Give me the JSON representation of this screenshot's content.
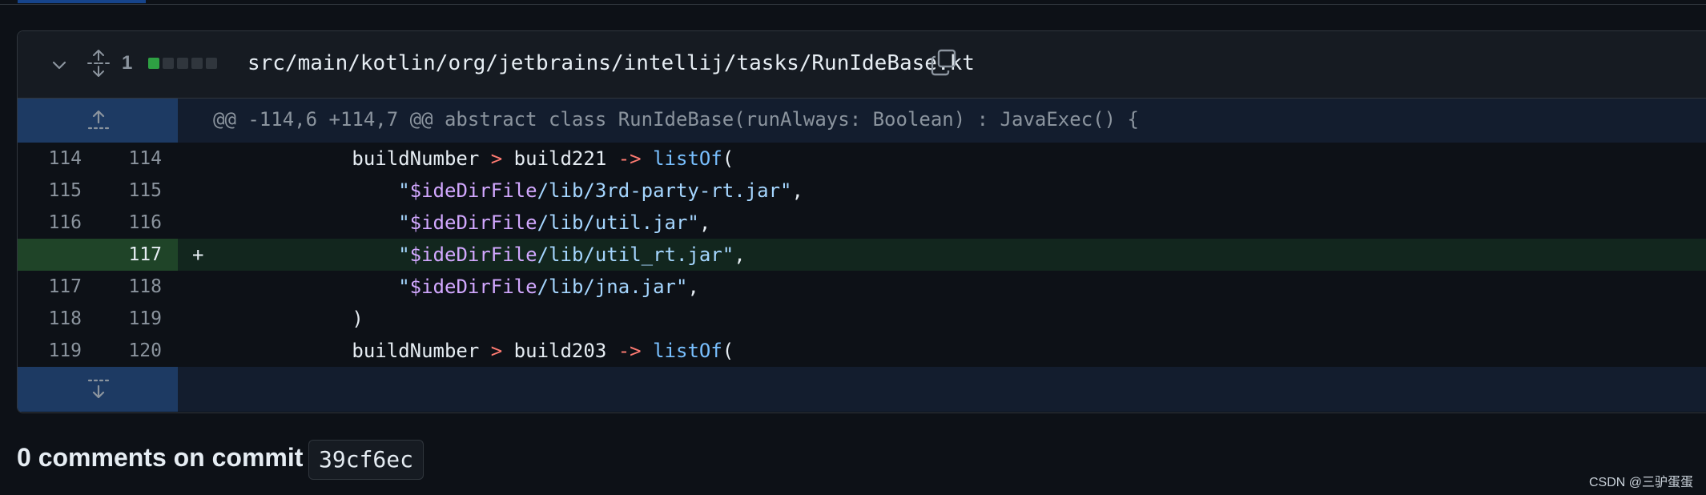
{
  "file": {
    "changed_count": "1",
    "diffstat": [
      "added",
      "neutral",
      "neutral",
      "neutral",
      "neutral"
    ],
    "path": "src/main/kotlin/org/jetbrains/intellij/tasks/RunIdeBase.kt",
    "icons": {
      "collapse": "chevron-down-icon",
      "expand_all": "unfold-icon",
      "copy": "copy-icon"
    }
  },
  "hunk": {
    "header": "@@ -114,6 +114,7 @@ abstract class RunIdeBase(runAlways: Boolean) : JavaExec() {"
  },
  "lines": [
    {
      "old": "114",
      "new": "114",
      "marker": "",
      "tokens": [
        [
          "",
          "            buildNumber "
        ],
        [
          "op",
          ">"
        ],
        [
          "",
          " build221 "
        ],
        [
          "op",
          "->"
        ],
        [
          "",
          " "
        ],
        [
          "fn",
          "listOf"
        ],
        [
          "",
          "("
        ]
      ]
    },
    {
      "old": "115",
      "new": "115",
      "marker": "",
      "tokens": [
        [
          "",
          "                "
        ],
        [
          "str",
          "\""
        ],
        [
          "var",
          "$ideDirFile"
        ],
        [
          "str",
          "/lib/3rd-party-rt.jar\""
        ],
        [
          "",
          ","
        ]
      ]
    },
    {
      "old": "116",
      "new": "116",
      "marker": "",
      "tokens": [
        [
          "",
          "                "
        ],
        [
          "str",
          "\""
        ],
        [
          "var",
          "$ideDirFile"
        ],
        [
          "str",
          "/lib/util.jar\""
        ],
        [
          "",
          ","
        ]
      ]
    },
    {
      "old": "",
      "new": "117",
      "marker": "+",
      "added": true,
      "tokens": [
        [
          "",
          "                "
        ],
        [
          "str",
          "\""
        ],
        [
          "var",
          "$ideDirFile"
        ],
        [
          "str",
          "/lib/util_rt.jar\""
        ],
        [
          "",
          ","
        ]
      ]
    },
    {
      "old": "117",
      "new": "118",
      "marker": "",
      "tokens": [
        [
          "",
          "                "
        ],
        [
          "str",
          "\""
        ],
        [
          "var",
          "$ideDirFile"
        ],
        [
          "str",
          "/lib/jna.jar\""
        ],
        [
          "",
          ","
        ]
      ]
    },
    {
      "old": "118",
      "new": "119",
      "marker": "",
      "tokens": [
        [
          "",
          "            )"
        ]
      ]
    },
    {
      "old": "119",
      "new": "120",
      "marker": "",
      "tokens": [
        [
          "",
          "            buildNumber "
        ],
        [
          "op",
          ">"
        ],
        [
          "",
          " build203 "
        ],
        [
          "op",
          "->"
        ],
        [
          "",
          " "
        ],
        [
          "fn",
          "listOf"
        ],
        [
          "",
          "("
        ]
      ]
    }
  ],
  "comments": {
    "title": "0 comments on commit",
    "sha": "39cf6ec"
  },
  "watermark": "CSDN @三驴蛋蛋",
  "colors": {
    "added_bg": "#12261e",
    "added_gutter": "#1f4428",
    "expand_gutter": "#1d3a63",
    "keyword": "#ff7b72",
    "function": "#79c0ff",
    "variable": "#d2a8ff",
    "string": "#a5d6ff"
  }
}
